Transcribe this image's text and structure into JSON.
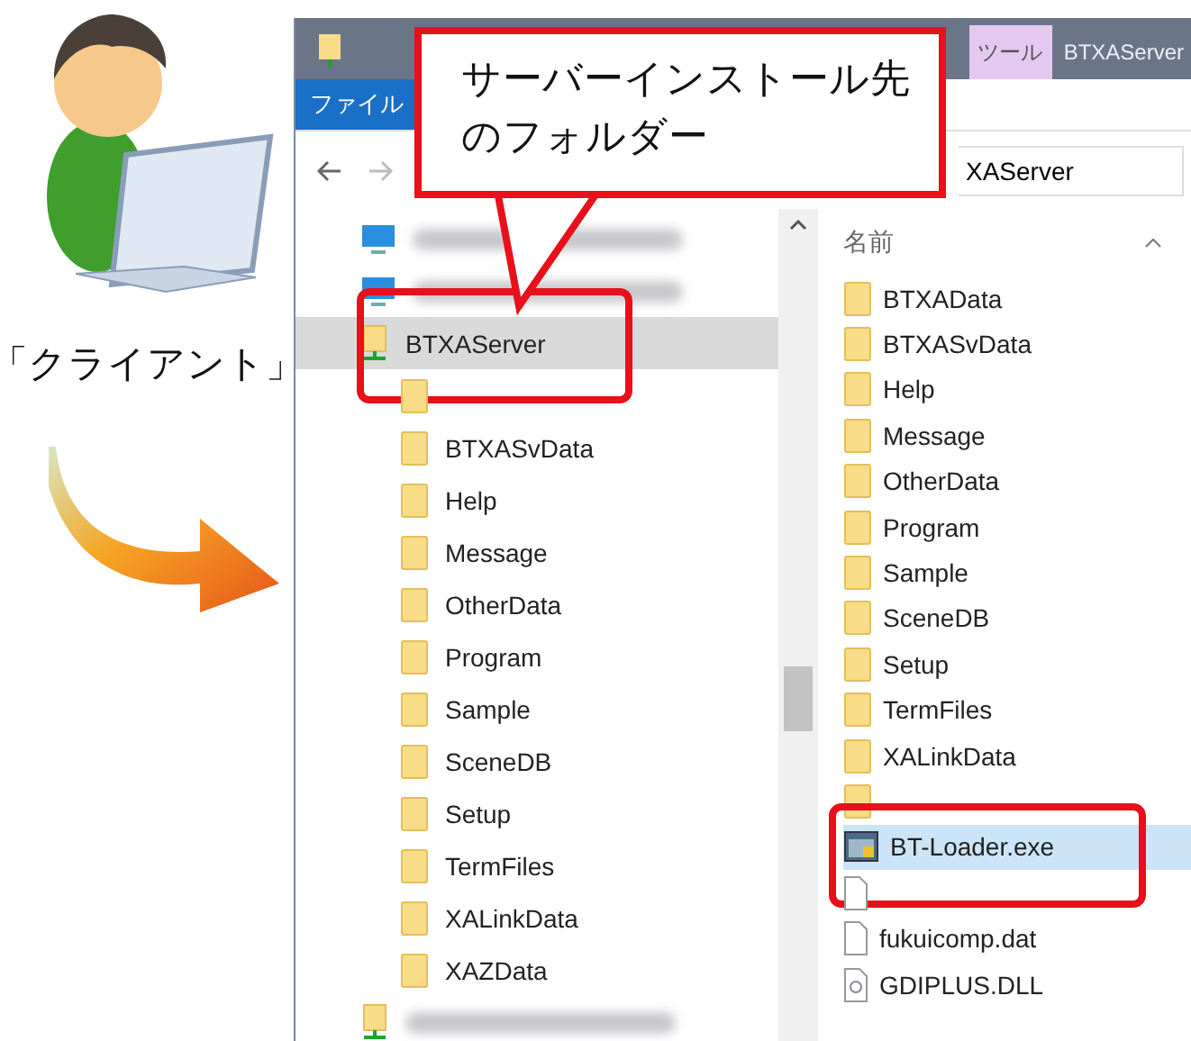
{
  "client_label": "「クライアント」",
  "callout": {
    "lines": [
      "サーバーインストール先",
      "のフォルダー"
    ]
  },
  "window": {
    "title_tabs": [
      {
        "label": "ツール",
        "kind": "context"
      },
      {
        "label": "BTXAServer",
        "kind": "plain"
      }
    ],
    "ribbon_tab": "ファイル",
    "address": "XAServer",
    "nav": [
      {
        "kind": "pc",
        "selected": false,
        "highlighted": false
      },
      {
        "kind": "pc",
        "selected": false,
        "highlighted": false
      },
      {
        "kind": "network",
        "label": "BTXAServer",
        "selected": true,
        "highlighted": true,
        "children": [
          {
            "kind": "folder"
          },
          {
            "kind": "folder",
            "label": "BTXASvData"
          },
          {
            "kind": "folder",
            "label": "Help"
          },
          {
            "kind": "folder",
            "label": "Message"
          },
          {
            "kind": "folder",
            "label": "OtherData"
          },
          {
            "kind": "folder",
            "label": "Program"
          },
          {
            "kind": "folder",
            "label": "Sample"
          },
          {
            "kind": "folder",
            "label": "SceneDB"
          },
          {
            "kind": "folder",
            "label": "Setup"
          },
          {
            "kind": "folder",
            "label": "TermFiles"
          },
          {
            "kind": "folder",
            "label": "XALinkData"
          },
          {
            "kind": "folder",
            "label": "XAZData"
          }
        ]
      },
      {
        "kind": "network",
        "selected": false,
        "highlighted": false
      }
    ],
    "column_header": "名前",
    "files": [
      {
        "kind": "folder",
        "label": "BTXAData",
        "selected": false,
        "highlighted": false
      },
      {
        "kind": "folder",
        "label": "BTXASvData",
        "selected": false,
        "highlighted": false
      },
      {
        "kind": "folder",
        "label": "Help",
        "selected": false,
        "highlighted": false
      },
      {
        "kind": "folder",
        "label": "Message",
        "selected": false,
        "highlighted": false
      },
      {
        "kind": "folder",
        "label": "OtherData",
        "selected": false,
        "highlighted": false
      },
      {
        "kind": "folder",
        "label": "Program",
        "selected": false,
        "highlighted": false
      },
      {
        "kind": "folder",
        "label": "Sample",
        "selected": false,
        "highlighted": false
      },
      {
        "kind": "folder",
        "label": "SceneDB",
        "selected": false,
        "highlighted": false
      },
      {
        "kind": "folder",
        "label": "Setup",
        "selected": false,
        "highlighted": false
      },
      {
        "kind": "folder",
        "label": "TermFiles",
        "selected": false,
        "highlighted": false
      },
      {
        "kind": "folder",
        "label": "XALinkData",
        "selected": false,
        "highlighted": false
      },
      {
        "kind": "folder",
        "selected": false,
        "highlighted": false
      },
      {
        "kind": "exe",
        "label": "BT-Loader.exe",
        "selected": true,
        "highlighted": true
      },
      {
        "kind": "file",
        "selected": false,
        "highlighted": false
      },
      {
        "kind": "file",
        "label": "fukuicomp.dat",
        "selected": false,
        "highlighted": false
      },
      {
        "kind": "dll",
        "label": "GDIPLUS.DLL",
        "selected": false,
        "highlighted": false
      }
    ]
  }
}
